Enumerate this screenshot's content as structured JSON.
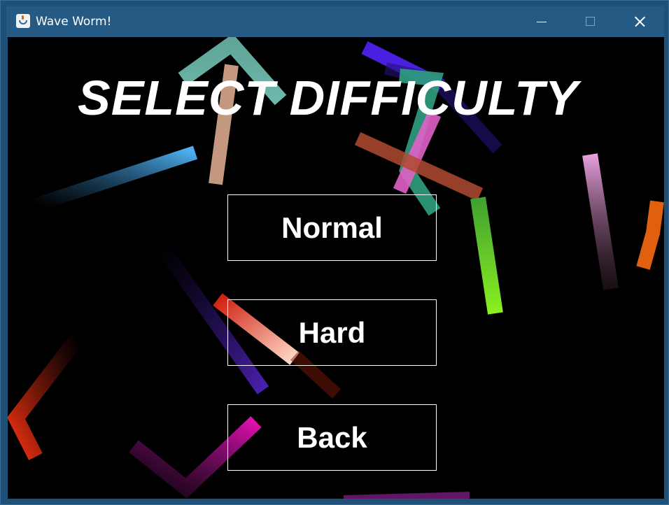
{
  "window": {
    "title": "Wave Worm!",
    "icon": "java-cup-icon",
    "controls": [
      "minimize-icon",
      "maximize-icon",
      "close-icon"
    ]
  },
  "menu": {
    "heading": "SELECT DIFFICULTY",
    "buttons": [
      {
        "label": "Normal"
      },
      {
        "label": "Hard"
      },
      {
        "label": "Back"
      }
    ]
  },
  "colors": {
    "background": "#000000",
    "text": "#ffffff",
    "titlebar": "#245a84",
    "worm_colors": [
      "#7fd8c8",
      "#d8a88c",
      "#4aa8e8",
      "#4a20e0",
      "#e060c8",
      "#b04a30",
      "#30a080",
      "#80f020",
      "#e8a0e0",
      "#e06010",
      "#3a20a0",
      "#e03010",
      "#ffd0c0",
      "#f03010",
      "#e010b0",
      "#a020a0"
    ]
  }
}
